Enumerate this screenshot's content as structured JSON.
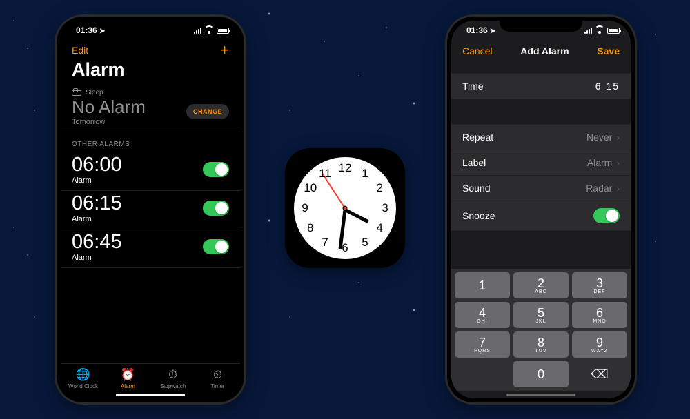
{
  "status": {
    "time": "01:36"
  },
  "left": {
    "edit": "Edit",
    "title": "Alarm",
    "sleep_label": "Sleep",
    "no_alarm": "No Alarm",
    "no_alarm_sub": "Tomorrow",
    "change": "CHANGE",
    "other_header": "OTHER ALARMS",
    "alarms": [
      {
        "time": "06:00",
        "label": "Alarm",
        "on": true
      },
      {
        "time": "06:15",
        "label": "Alarm",
        "on": true
      },
      {
        "time": "06:45",
        "label": "Alarm",
        "on": true
      }
    ],
    "tabs": [
      {
        "label": "World Clock",
        "icon": "globe-icon"
      },
      {
        "label": "Alarm",
        "icon": "alarm-icon",
        "active": true
      },
      {
        "label": "Stopwatch",
        "icon": "stopwatch-icon"
      },
      {
        "label": "Timer",
        "icon": "timer-icon"
      }
    ]
  },
  "right": {
    "cancel": "Cancel",
    "title": "Add Alarm",
    "save": "Save",
    "time_label": "Time",
    "time_value": "6 15",
    "repeat_label": "Repeat",
    "repeat_value": "Never",
    "label_label": "Label",
    "label_value": "Alarm",
    "sound_label": "Sound",
    "sound_value": "Radar",
    "snooze_label": "Snooze",
    "keypad": [
      {
        "n": "1",
        "l": ""
      },
      {
        "n": "2",
        "l": "ABC"
      },
      {
        "n": "3",
        "l": "DEF"
      },
      {
        "n": "4",
        "l": "GHI"
      },
      {
        "n": "5",
        "l": "JKL"
      },
      {
        "n": "6",
        "l": "MNO"
      },
      {
        "n": "7",
        "l": "PQRS"
      },
      {
        "n": "8",
        "l": "TUV"
      },
      {
        "n": "9",
        "l": "WXYZ"
      },
      {
        "blank": true
      },
      {
        "n": "0",
        "l": ""
      },
      {
        "del": true
      }
    ]
  },
  "clock": {
    "hours_angle": 27,
    "minutes_angle": 97,
    "seconds_angle": 237,
    "numbers": [
      "12",
      "1",
      "2",
      "3",
      "4",
      "5",
      "6",
      "7",
      "8",
      "9",
      "10",
      "11"
    ]
  }
}
